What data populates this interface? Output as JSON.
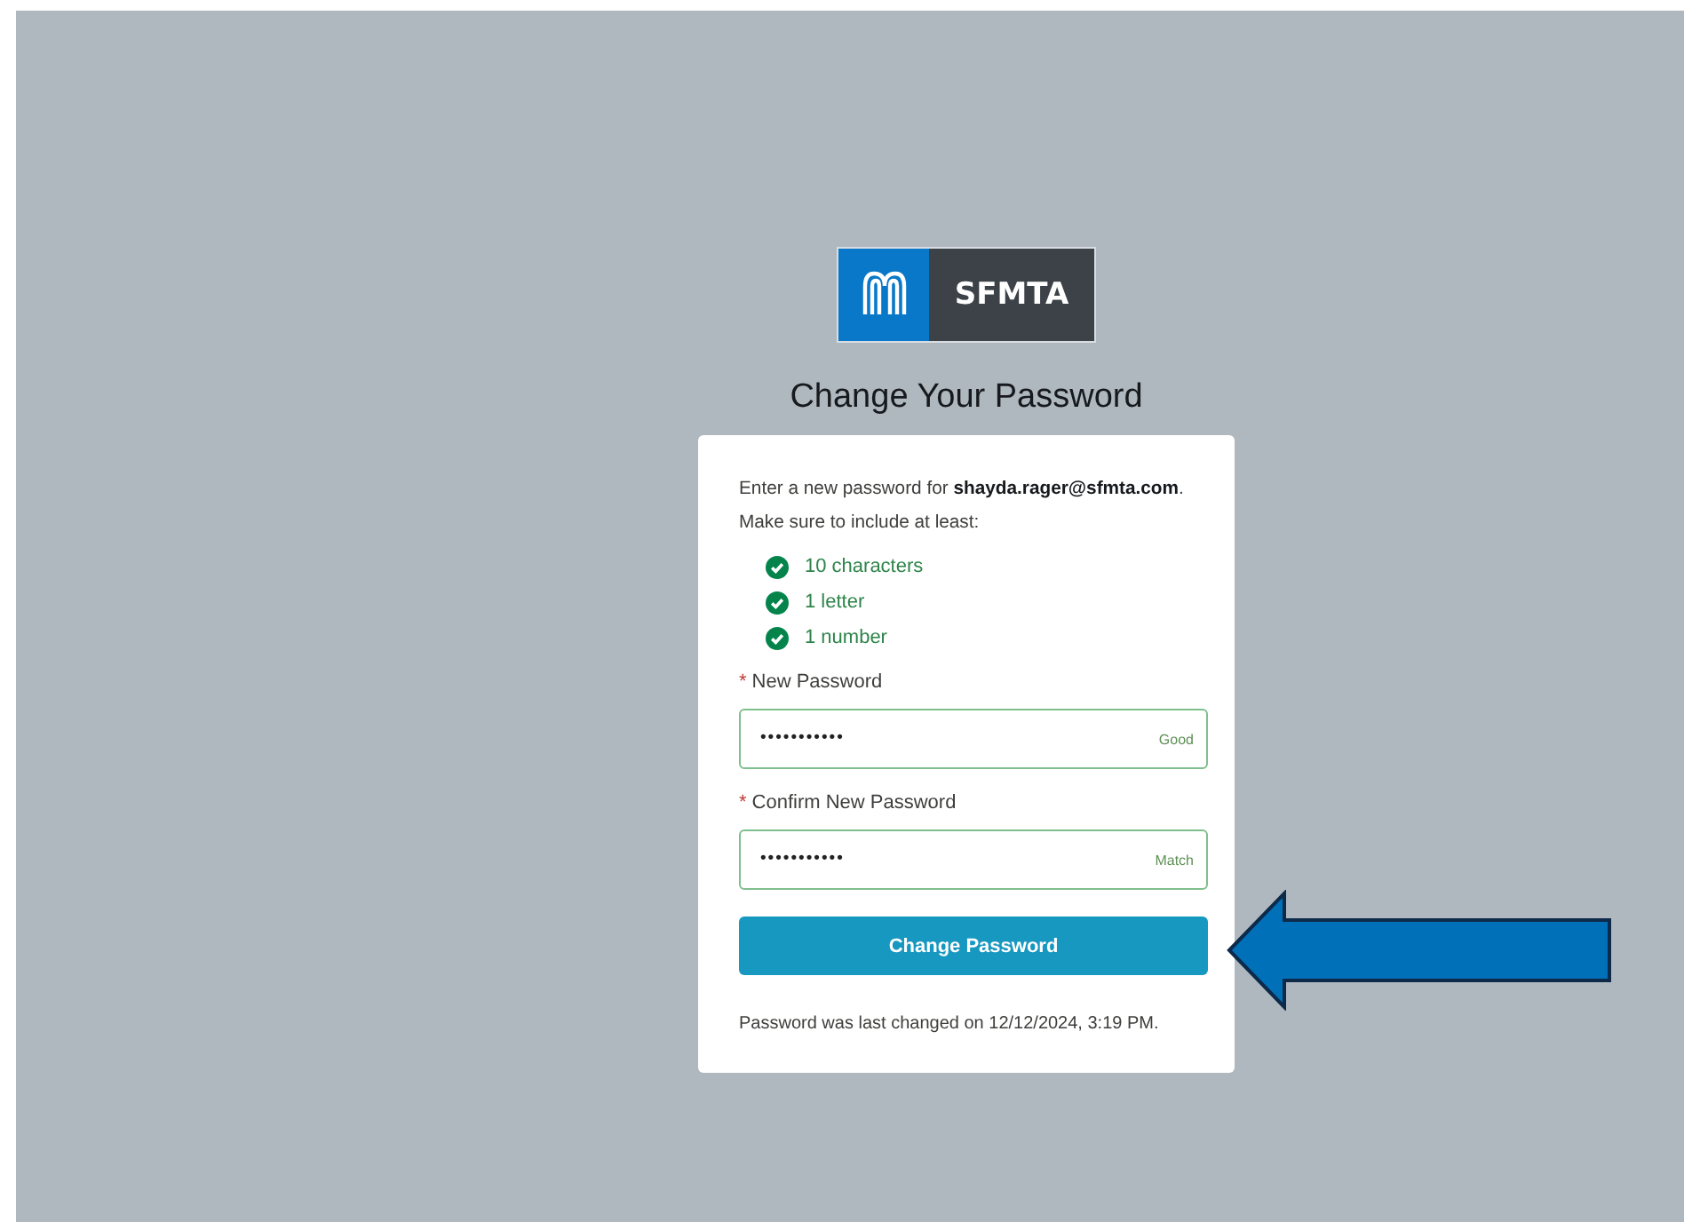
{
  "logo": {
    "text": "SFMTA"
  },
  "title": "Change Your Password",
  "intro": [
    "Enter a new password for **shayda.rager@sfmta.com**.",
    "Make sure to include at least:"
  ],
  "requirements": [
    {
      "label": "10 characters",
      "checked": true
    },
    {
      "label": "1 letter",
      "checked": true
    },
    {
      "label": "1 number",
      "checked": true
    }
  ],
  "fields": [
    {
      "mark": "*",
      "label": "New Password",
      "value": "•••••••••••",
      "hint": "Good"
    },
    {
      "mark": "*",
      "label": "Confirm New Password",
      "value": "•••••••••••",
      "hint": "Match"
    }
  ],
  "submit": "Change Password",
  "footer": "Password was last changed on 12/12/2024, 3:19 PM.",
  "annotation": {
    "kind": "arrow"
  }
}
